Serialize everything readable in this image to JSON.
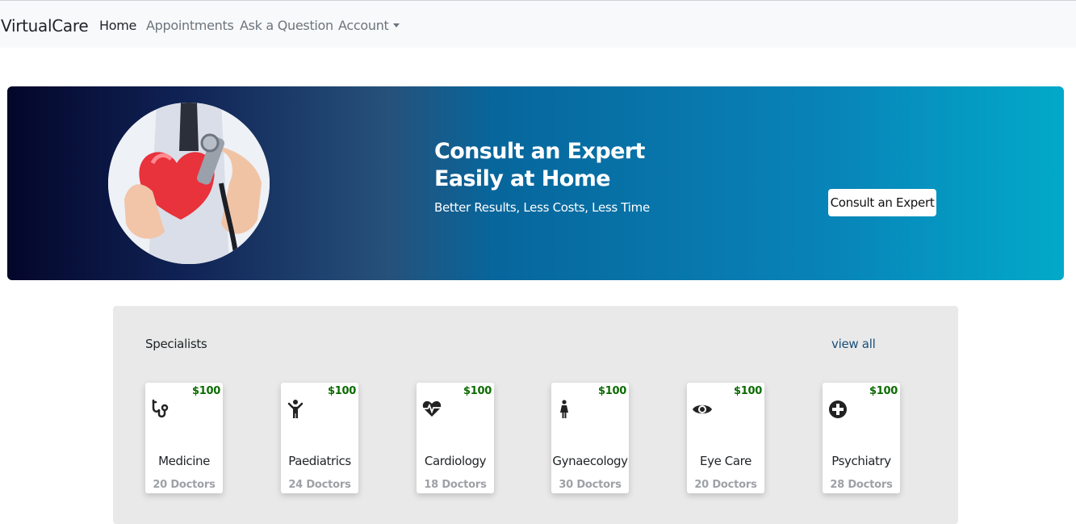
{
  "navbar": {
    "brand": "VirtualCare",
    "links": [
      "Home",
      "Appointments",
      "Ask a Question",
      "Account"
    ]
  },
  "hero": {
    "title_line1": "Consult an Expert",
    "title_line2": "Easily at Home",
    "subtitle": "Better Results, Less Costs, Less Time",
    "button": "Consult an Expert"
  },
  "specialists": {
    "title": "Specialists",
    "view_all": "view all",
    "cards": [
      {
        "name": "Medicine",
        "price": "$100",
        "count": "20 Doctors",
        "icon": "stethoscope-icon"
      },
      {
        "name": "Paediatrics",
        "price": "$100",
        "count": "24 Doctors",
        "icon": "child-icon"
      },
      {
        "name": "Cardiology",
        "price": "$100",
        "count": "18 Doctors",
        "icon": "heartbeat-icon"
      },
      {
        "name": "Gynaecology",
        "price": "$100",
        "count": "30 Doctors",
        "icon": "female-icon"
      },
      {
        "name": "Eye Care",
        "price": "$100",
        "count": "20 Doctors",
        "icon": "eye-icon"
      },
      {
        "name": "Psychiatry",
        "price": "$100",
        "count": "28 Doctors",
        "icon": "plus-circle-icon"
      }
    ]
  },
  "colors": {
    "navbar_bg": "#f8f9fa",
    "price": "#0b6b00",
    "link": "#1a4f7a",
    "panel_bg": "#e9e9e9"
  }
}
